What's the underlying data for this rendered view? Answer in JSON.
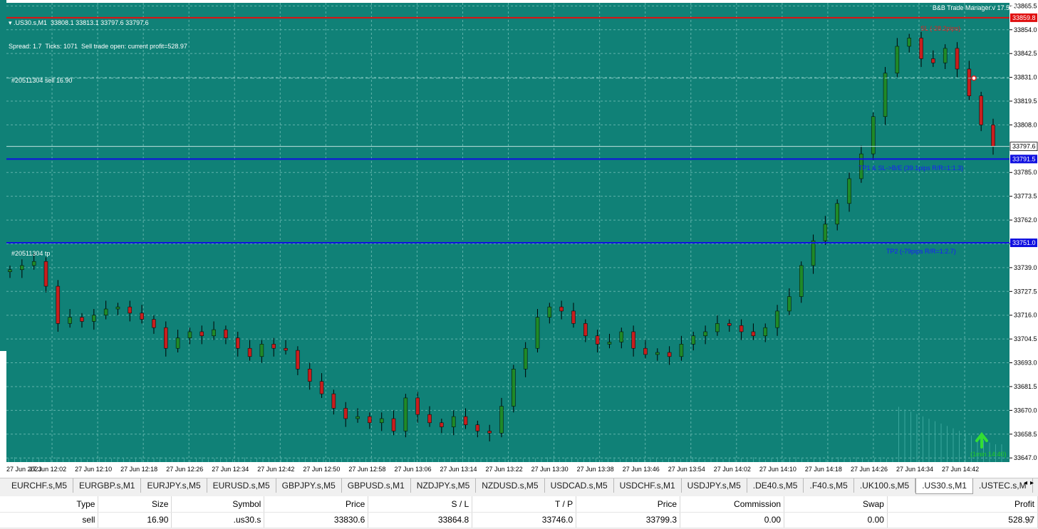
{
  "chart": {
    "symbol_header": "▾ .US30.s,M1  33808.1 33813.1 33797.6 33797.6",
    "status_line": "Spread: 1.7  Ticks: 1071  Sell trade open: current profit=528.97",
    "ea_title": "B&B Trade Manager.v 17.5",
    "order_label": "#20511304 sell 16.90",
    "tp_label": "#20511304 tp",
    "sl_text": "SL (-28.2pips)",
    "tp1_text": "TP1 & SL->B/E (39.1pips R/R=1:1.3)",
    "tp2_text": "TP2 (-79pips R/R=1:2.7)",
    "timer_text": "(1min 14:40)",
    "price_ticks": [
      "33865.5",
      "33854.0",
      "33842.5",
      "33831.0",
      "33819.5",
      "33808.0",
      "33785.0",
      "33773.5",
      "33762.0",
      "33750.5",
      "33739.0",
      "33727.5",
      "33716.0",
      "33704.5",
      "33693.0",
      "33681.5",
      "33670.0",
      "33658.5",
      "33647.0"
    ],
    "current_price": "33797.6",
    "sl_price": "33859.8",
    "tp1_price": "33791.5",
    "tp2_price": "33751.0",
    "time_ticks": [
      "27 Jun 2023",
      "27 Jun 12:02",
      "27 Jun 12:10",
      "27 Jun 12:18",
      "27 Jun 12:26",
      "27 Jun 12:34",
      "27 Jun 12:42",
      "27 Jun 12:50",
      "27 Jun 12:58",
      "27 Jun 13:06",
      "27 Jun 13:14",
      "27 Jun 13:22",
      "27 Jun 13:30",
      "27 Jun 13:38",
      "27 Jun 13:46",
      "27 Jun 13:54",
      "27 Jun 14:02",
      "27 Jun 14:10",
      "27 Jun 14:18",
      "27 Jun 14:26",
      "27 Jun 14:34",
      "27 Jun 14:42"
    ],
    "colors": {
      "background": "#108177",
      "bull": "#1f8a28",
      "bear": "#c81e1e",
      "sl_line": "#e01010",
      "tp_line": "#1010e0",
      "grid": "#5fb3ab"
    },
    "close_path": [
      33738,
      33740,
      33742,
      33730,
      33712,
      33715,
      33713,
      33716,
      33719,
      33720,
      33717,
      33714,
      33710,
      33700,
      33705,
      33708,
      33706,
      33709,
      33705,
      33700,
      33696,
      33702,
      33700,
      33699,
      33690,
      33684,
      33678,
      33671,
      33666,
      33667,
      33664,
      33666,
      33660,
      33676,
      33668,
      33664,
      33662,
      33667,
      33663,
      33660,
      33659,
      33672,
      33690,
      33700,
      33715,
      33720,
      33718,
      33712,
      33706,
      33702,
      33703,
      33708,
      33700,
      33697,
      33698,
      33696,
      33702,
      33706,
      33708,
      33712,
      33711,
      33708,
      33706,
      33710,
      33718,
      33725,
      33740,
      33752,
      33760,
      33770,
      33782,
      33794,
      33812,
      33833,
      33846,
      33850,
      33840,
      33838,
      33845,
      33835,
      33822,
      33808,
      33797.6
    ]
  },
  "tabs": [
    {
      "label": "EURCHF.s,M5"
    },
    {
      "label": "EURGBP.s,M1"
    },
    {
      "label": "EURJPY.s,M5"
    },
    {
      "label": "EURUSD.s,M5"
    },
    {
      "label": "GBPJPY.s,M5"
    },
    {
      "label": "GBPUSD.s,M1"
    },
    {
      "label": "NZDJPY.s,M5"
    },
    {
      "label": "NZDUSD.s,M5"
    },
    {
      "label": "USDCAD.s,M5"
    },
    {
      "label": "USDCHF.s,M1"
    },
    {
      "label": "USDJPY.s,M5"
    },
    {
      "label": ".DE40.s,M5"
    },
    {
      "label": ".F40.s,M5"
    },
    {
      "label": ".UK100.s,M5"
    },
    {
      "label": ".US30.s,M1"
    },
    {
      "label": ".USTEC.s,M"
    }
  ],
  "table": {
    "headers": [
      "Type",
      "Size",
      "Symbol",
      "Price",
      "S / L",
      "T / P",
      "Price",
      "Commission",
      "Swap",
      "Profit"
    ],
    "row": [
      "sell",
      "16.90",
      ".us30.s",
      "33830.6",
      "33864.8",
      "33746.0",
      "33799.3",
      "0.00",
      "0.00",
      "528.97"
    ]
  }
}
